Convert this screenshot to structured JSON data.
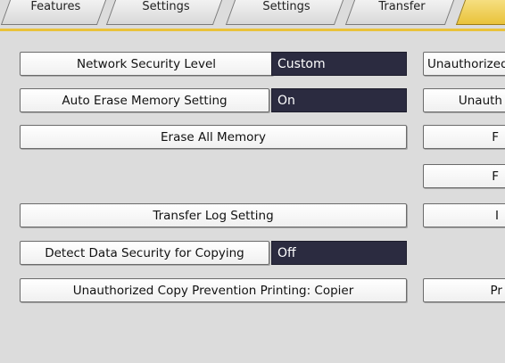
{
  "tabs": [
    {
      "label": "Features"
    },
    {
      "label": "Settings"
    },
    {
      "label": "Settings"
    },
    {
      "label": "Transfer"
    },
    {
      "label": ""
    }
  ],
  "left": {
    "network_security_level": {
      "label": "Network Security Level",
      "value": "Custom"
    },
    "auto_erase_memory": {
      "label": "Auto Erase Memory Setting",
      "value": "On"
    },
    "erase_all_memory": {
      "label": "Erase All Memory"
    },
    "transfer_log_setting": {
      "label": "Transfer Log Setting"
    },
    "detect_data_security": {
      "label": "Detect Data Security for Copying",
      "value": "Off"
    },
    "unauth_copy_prevention": {
      "label": "Unauthorized Copy Prevention Printing: Copier"
    }
  },
  "right": [
    {
      "label": "Unauthorized"
    },
    {
      "label": "Unauth"
    },
    {
      "label": "F"
    },
    {
      "label": "F"
    },
    {
      "label": "I"
    },
    {
      "label": "Pr"
    }
  ]
}
